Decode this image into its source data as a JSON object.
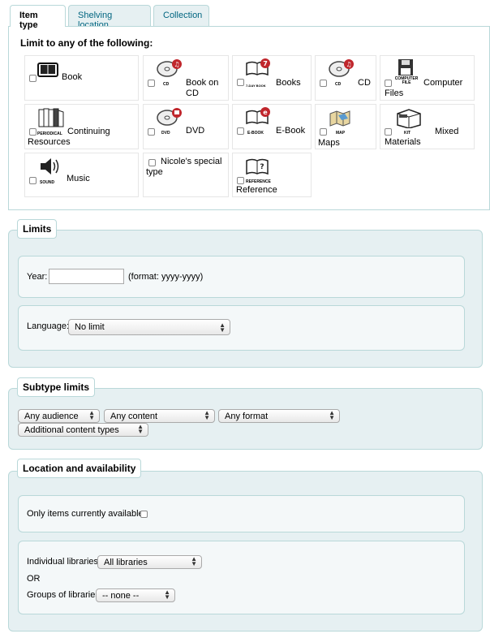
{
  "tabs": [
    {
      "label": "Item type"
    },
    {
      "label": "Shelving location"
    },
    {
      "label": "Collection"
    }
  ],
  "item_types": {
    "heading": "Limit to any of the following:",
    "items": [
      {
        "label": "Book",
        "icon": "book-icon"
      },
      {
        "label": "Book on CD",
        "icon": "cd-icon",
        "icon_caption": "CD"
      },
      {
        "label": "Books",
        "icon": "7-day-book-icon",
        "icon_caption": "7-DAY BOOK"
      },
      {
        "label": "CD",
        "icon": "cd-icon",
        "icon_caption": "CD"
      },
      {
        "label": "Computer Files",
        "icon": "computer-file-icon",
        "icon_caption": "COMPUTER FILE"
      },
      {
        "label": "Continuing Resources",
        "icon": "periodical-icon",
        "icon_caption": "PERIODICAL"
      },
      {
        "label": "DVD",
        "icon": "dvd-icon",
        "icon_caption": "DVD"
      },
      {
        "label": "E-Book",
        "icon": "e-book-icon",
        "icon_caption": "E-BOOK"
      },
      {
        "label": "Maps",
        "icon": "map-icon",
        "icon_caption": "MAP"
      },
      {
        "label": "Mixed Materials",
        "icon": "kit-icon",
        "icon_caption": "KIT"
      },
      {
        "label": "Music",
        "icon": "sound-icon",
        "icon_caption": "SOUND"
      },
      {
        "label": "Nicole's special type",
        "icon": ""
      },
      {
        "label": "Reference",
        "icon": "reference-icon",
        "icon_caption": "REFERENCE"
      }
    ]
  },
  "limits": {
    "legend": "Limits",
    "year_label": "Year:",
    "year_value": "",
    "year_format": "(format: yyyy-yyyy)",
    "language_label": "Language:",
    "language_value": "No limit"
  },
  "subtype": {
    "legend": "Subtype limits",
    "audience": "Any audience",
    "content": "Any content",
    "format": "Any format",
    "additional": "Additional content types"
  },
  "location": {
    "legend": "Location and availability",
    "available_label": "Only items currently available",
    "libraries_label": "Individual libraries:",
    "libraries_value": "All libraries",
    "or_label": "OR",
    "groups_label": "Groups of libraries",
    "groups_value": "-- none --"
  },
  "colors": {
    "border": "#b9d8d9",
    "panel_bg": "#e6f0f2",
    "tab_text": "#006580",
    "badge_red": "#c0262c"
  }
}
